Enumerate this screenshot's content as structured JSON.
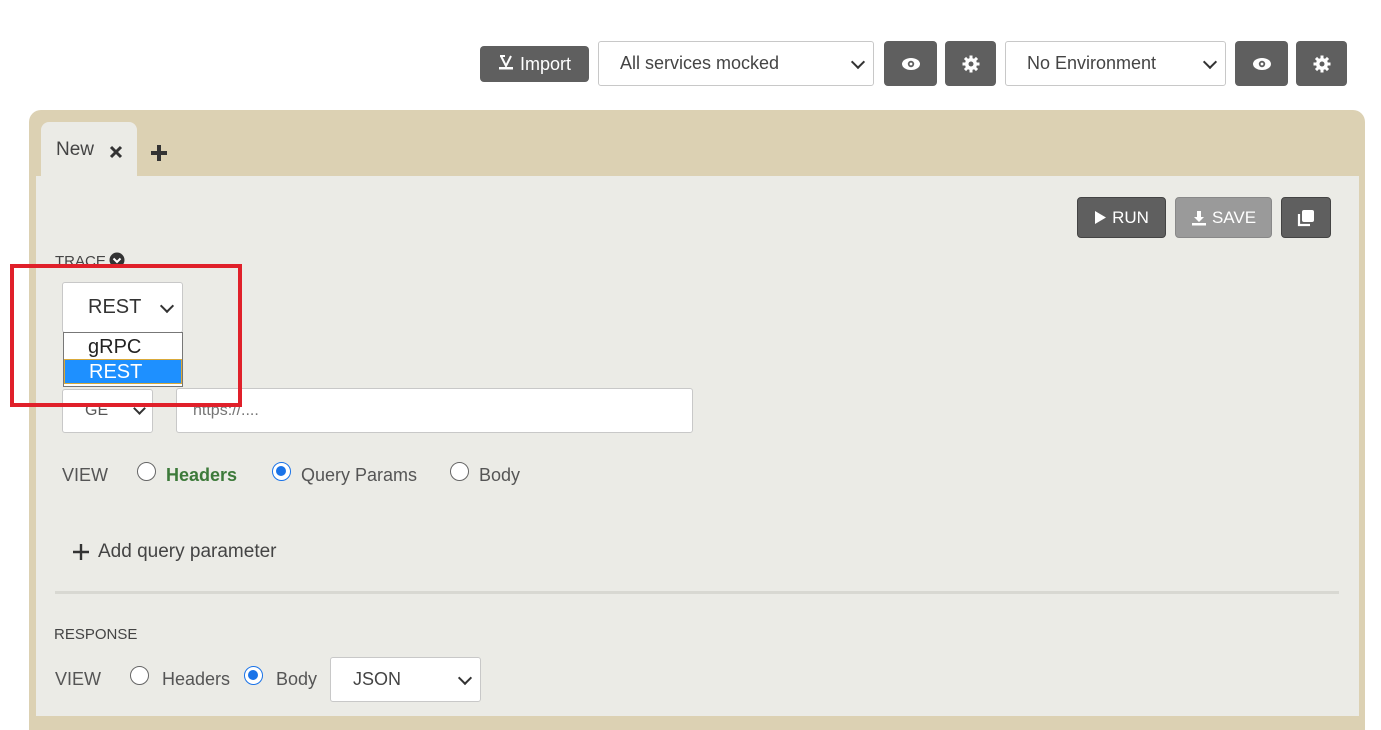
{
  "toolbar": {
    "import_label": "Import",
    "services_select": "All services mocked",
    "environment_select": "No Environment"
  },
  "tabs": [
    {
      "label": "New"
    }
  ],
  "actions": {
    "run_label": "RUN",
    "save_label": "SAVE"
  },
  "trace": {
    "label": "TRACE",
    "protocol_selected": "REST",
    "protocol_options": [
      "gRPC",
      "REST"
    ],
    "highlighted_option": "REST"
  },
  "request": {
    "method": "GE",
    "url_placeholder": "https://....",
    "view_label": "VIEW",
    "view_options": [
      "Headers",
      "Query Params",
      "Body"
    ],
    "view_selected": "Query Params",
    "add_param_label": "Add query parameter"
  },
  "response": {
    "label": "RESPONSE",
    "view_label": "VIEW",
    "view_options": [
      "Headers",
      "Body"
    ],
    "view_selected": "Body",
    "format_select": "JSON"
  },
  "colors": {
    "panel_outer": "#dcd1b3",
    "panel_inner": "#ebebe6",
    "dark_button": "#5f5f5f",
    "highlight_box": "#e0202a",
    "selected_option": "#1e90ff",
    "headers_green": "#3d7a3a"
  }
}
